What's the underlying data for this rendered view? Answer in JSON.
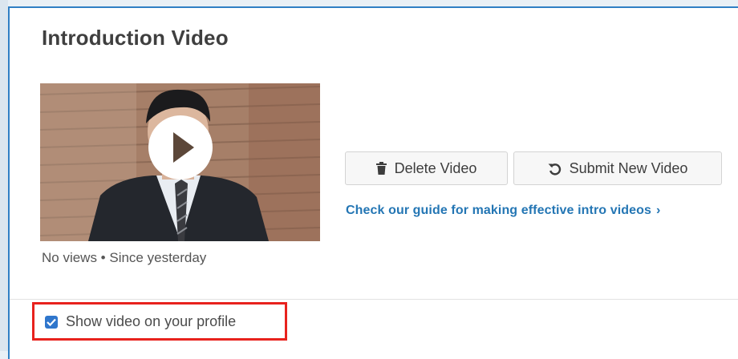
{
  "section": {
    "title": "Introduction Video"
  },
  "video": {
    "stats": "No views • Since yesterday"
  },
  "actions": {
    "delete_label": "Delete Video",
    "submit_label": "Submit New Video"
  },
  "guide": {
    "link_text": "Check our guide for making effective intro videos",
    "chevron": "›"
  },
  "profile_option": {
    "label": "Show video on your profile",
    "checked": true
  },
  "colors": {
    "accent": "#2f7fc4",
    "link": "#2476b4",
    "highlight": "#e8221d",
    "checkbox": "#2f76cc"
  },
  "icons": {
    "delete": "trash-icon",
    "submit": "undo-icon",
    "play": "play-icon",
    "check": "check-icon"
  }
}
